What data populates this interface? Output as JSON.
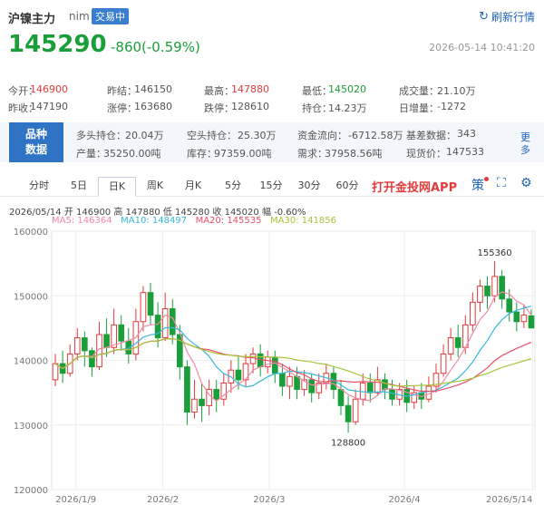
{
  "header": {
    "name": "沪镍主力",
    "code": "nim",
    "badge": "交易中",
    "refresh": "刷新行情",
    "price": "145290",
    "change": "-860(-0.59%)",
    "timestamp": "2026-05-14 10:41:20"
  },
  "quote": {
    "open_label": "今开：",
    "open": "146900",
    "prev_close_label": "昨结：",
    "prev_close": "146150",
    "high_label": "最高：",
    "high": "147880",
    "low_label": "最低：",
    "low": "145020",
    "volume_label": "成交量：",
    "volume": "21.10万",
    "prev_settle_label": "昨收：",
    "prev_settle": "147190",
    "limit_up_label": "涨停：",
    "limit_up": "163680",
    "limit_down_label": "跌停：",
    "limit_down": "128610",
    "open_interest_label": "持仓：",
    "open_interest": "14.23万",
    "daily_add_label": "日增量：",
    "daily_add": "-1272"
  },
  "fundamentals": {
    "label_line1": "品种",
    "label_line2": "数据",
    "long_label": "多头持仓：",
    "long": "20.04万",
    "short_label": "空头持仓：",
    "short": "25.30万",
    "flow_label": "资金流向：",
    "flow": "-6712.58万",
    "basis_label": "基差数据：",
    "basis": "343",
    "output_label": "产量：",
    "output": "35250.00吨",
    "stock_label": "库存：",
    "stock": "97359.00吨",
    "demand_label": "需求：",
    "demand": "37958.56吨",
    "spot_label": "现货价：",
    "spot": "147533",
    "more": "更多"
  },
  "tabs": [
    "分时",
    "5日",
    "日K",
    "周K",
    "月K",
    "5分",
    "15分",
    "30分",
    "60分"
  ],
  "active_tab": "日K",
  "app_link": "打开金投网APP",
  "ohlc_line": "2026/05/14 开 146900 高 147880 低 145280 收 145020 幅 -0.60%",
  "ma_legend": {
    "ma5": "MA5: 146364",
    "ma10": "MA10: 148497",
    "ma20": "MA20: 145535",
    "ma30": "MA30: 141856"
  },
  "colors": {
    "up": "#e23b3b",
    "down": "#1a9e3a",
    "ma5": "#f08aa6",
    "ma10": "#39b9d8",
    "ma20": "#e8506a",
    "ma30": "#a8c43a"
  },
  "chart_data": {
    "type": "candlestick",
    "ylim": [
      120000,
      160000
    ],
    "y_ticks": [
      "160000",
      "150000",
      "140000",
      "130000",
      "120000"
    ],
    "x_ticks": [
      "2026/1/9",
      "2026/2",
      "2026/3",
      "2026/4",
      "2026/5/14"
    ],
    "annotations": [
      {
        "label": "155360",
        "value": 155360
      },
      {
        "label": "128800",
        "value": 128800
      }
    ],
    "candles": [
      [
        137000,
        139500,
        136000,
        141000
      ],
      [
        139500,
        138000,
        136500,
        141500
      ],
      [
        138000,
        141000,
        137500,
        142500
      ],
      [
        141000,
        143500,
        140000,
        145000
      ],
      [
        143500,
        141500,
        139000,
        144500
      ],
      [
        141500,
        139000,
        137500,
        142000
      ],
      [
        139000,
        144000,
        138500,
        146000
      ],
      [
        144000,
        142000,
        140500,
        146500
      ],
      [
        142000,
        145500,
        141000,
        148000
      ],
      [
        145500,
        143000,
        141500,
        147000
      ],
      [
        143000,
        141000,
        139500,
        145000
      ],
      [
        141000,
        146000,
        140000,
        148000
      ],
      [
        146000,
        150500,
        144500,
        151500
      ],
      [
        150500,
        147000,
        145500,
        152000
      ],
      [
        147000,
        143500,
        142000,
        149000
      ],
      [
        143500,
        148000,
        143000,
        150500
      ],
      [
        148000,
        144000,
        142500,
        149500
      ],
      [
        144000,
        139000,
        137000,
        145500
      ],
      [
        139000,
        132000,
        130000,
        140000
      ],
      [
        132000,
        134000,
        131000,
        137000
      ],
      [
        134000,
        133000,
        130500,
        136500
      ],
      [
        133000,
        135500,
        131500,
        137000
      ],
      [
        135500,
        134000,
        132000,
        137000
      ],
      [
        134000,
        136500,
        133000,
        138000
      ],
      [
        136500,
        138500,
        135000,
        140000
      ],
      [
        138500,
        137000,
        135500,
        140500
      ],
      [
        137000,
        139500,
        136000,
        141000
      ],
      [
        139500,
        141000,
        138000,
        142000
      ],
      [
        141000,
        139000,
        137500,
        142500
      ],
      [
        139000,
        140500,
        138000,
        141500
      ],
      [
        140500,
        138000,
        136500,
        141500
      ],
      [
        138000,
        136000,
        134500,
        139500
      ],
      [
        136000,
        137500,
        134000,
        139000
      ],
      [
        137500,
        135500,
        134000,
        139000
      ],
      [
        135500,
        137000,
        134500,
        138500
      ],
      [
        137000,
        135000,
        133500,
        138000
      ],
      [
        135000,
        136500,
        134000,
        138000
      ],
      [
        136500,
        138000,
        135500,
        139500
      ],
      [
        138000,
        135500,
        134000,
        139000
      ],
      [
        135500,
        133000,
        131500,
        137000
      ],
      [
        133000,
        130500,
        128800,
        134500
      ],
      [
        130500,
        134000,
        130000,
        135500
      ],
      [
        134000,
        136500,
        133000,
        138000
      ],
      [
        136500,
        135000,
        133500,
        138000
      ],
      [
        135000,
        137000,
        134500,
        139000
      ],
      [
        137000,
        135500,
        134000,
        138000
      ],
      [
        135500,
        134000,
        133000,
        137000
      ],
      [
        134000,
        135500,
        133000,
        136500
      ],
      [
        135500,
        133500,
        132000,
        137000
      ],
      [
        133500,
        135000,
        132500,
        136000
      ],
      [
        135000,
        134000,
        132500,
        136500
      ],
      [
        134000,
        136000,
        133500,
        137500
      ],
      [
        136000,
        138000,
        135000,
        139500
      ],
      [
        138000,
        141000,
        137500,
        142500
      ],
      [
        141000,
        143500,
        140000,
        145000
      ],
      [
        143500,
        142000,
        140500,
        145500
      ],
      [
        142000,
        145500,
        141000,
        147000
      ],
      [
        145500,
        149000,
        144500,
        150500
      ],
      [
        149000,
        151500,
        147500,
        152500
      ],
      [
        151500,
        150000,
        148000,
        153000
      ],
      [
        150000,
        153000,
        149000,
        155360
      ],
      [
        153000,
        149500,
        148000,
        154000
      ],
      [
        149500,
        147500,
        146000,
        151000
      ],
      [
        147500,
        146000,
        144500,
        149000
      ],
      [
        146000,
        147000,
        145000,
        148500
      ],
      [
        146900,
        145020,
        145280,
        147880
      ]
    ]
  }
}
